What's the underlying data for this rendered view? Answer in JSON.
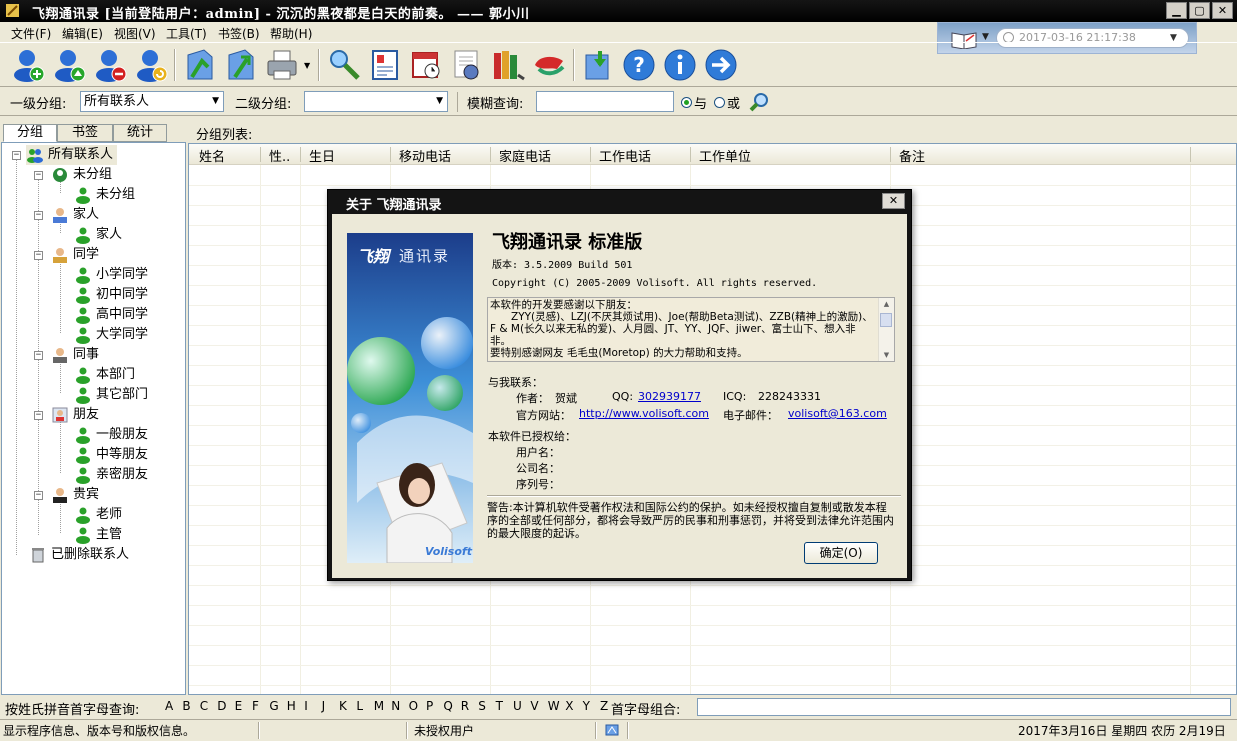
{
  "window": {
    "title": "飞翔通讯录  [当前登陆用户：admin]  -  沉沉的黑夜都是白天的前奏。 —— 郭小川"
  },
  "menu": [
    "文件(F)",
    "编辑(E)",
    "视图(V)",
    "工具(T)",
    "书签(B)",
    "帮助(H)"
  ],
  "date_widget": {
    "value": "2017-03-16 21:17:38"
  },
  "filters": {
    "group1_label": "一级分组:",
    "group1_value": "所有联系人",
    "group2_label": "二级分组:",
    "group2_value": "",
    "search_label": "模糊查询:",
    "search_value": "",
    "and_label": "与",
    "or_label": "或",
    "mode": "and"
  },
  "left_tabs": [
    "分组",
    "书签",
    "统计"
  ],
  "tree": {
    "root": "所有联系人",
    "groups": [
      {
        "label": "未分组",
        "children": [
          "未分组"
        ]
      },
      {
        "label": "家人",
        "children": [
          "家人"
        ]
      },
      {
        "label": "同学",
        "children": [
          "小学同学",
          "初中同学",
          "高中同学",
          "大学同学"
        ]
      },
      {
        "label": "同事",
        "children": [
          "本部门",
          "其它部门"
        ]
      },
      {
        "label": "朋友",
        "children": [
          "一般朋友",
          "中等朋友",
          "亲密朋友"
        ]
      },
      {
        "label": "贵宾",
        "children": [
          "老师",
          "主管"
        ]
      }
    ],
    "deleted": "已删除联系人"
  },
  "grid": {
    "label": "分组列表:",
    "columns": [
      "姓名",
      "性..",
      "生日",
      "移动电话",
      "家庭电话",
      "工作电话",
      "工作单位",
      "备注"
    ]
  },
  "alpha": {
    "label": "按姓氏拼音首字母查询:",
    "letters": [
      "A",
      "B",
      "C",
      "D",
      "E",
      "F",
      "G",
      "H",
      "I",
      "J",
      "K",
      "L",
      "M",
      "N",
      "O",
      "P",
      "Q",
      "R",
      "S",
      "T",
      "U",
      "V",
      "W",
      "X",
      "Y",
      "Z"
    ],
    "combo_label": "首字母组合:"
  },
  "status": {
    "message": "显示程序信息、版本号和版权信息。",
    "license": "未授权用户",
    "date": "2017年3月16日 星期四 农历 2月19日"
  },
  "about": {
    "title": "关于 飞翔通讯录",
    "banner_logo": "飞翔",
    "banner_text": "通讯录",
    "banner_brand": "Volisoft",
    "product": "飞翔通讯录 标准版",
    "version": "版本: 3.5.2009 Build 501",
    "copyright": "Copyright (C) 2005-2009 Volisoft. All rights reserved.",
    "thanks": [
      "本软件的开发要感谢以下朋友：",
      "　　ZYY(灵感)、LZJ(不厌其烦试用)、Joe(帮助Beta测试)、ZZB(精神上的激励)、F & M(长久以来无私的爱)、人月圆、JT、YY、JQF、jiwer、富士山下、想入非非。",
      "要特别感谢网友 毛毛虫(Moretop) 的大力帮助和支持。"
    ],
    "contact_label": "与我联系：",
    "author_label": "作者：",
    "author": "贺斌",
    "qq_label": "QQ:",
    "qq": "302939177",
    "icq_label": "ICQ:",
    "icq": "228243331",
    "site_label": "官方网站：",
    "site": "http://www.volisoft.com",
    "email_label": "电子邮件：",
    "email": "volisoft@163.com",
    "licensed_label": "本软件已授权给：",
    "user_label": "用户名：",
    "company_label": "公司名：",
    "serial_label": "序列号：",
    "warning": "警告:本计算机软件受著作权法和国际公约的保护。如未经授权擅自复制或散发本程序的全部或任何部分，都将会导致严厉的民事和刑事惩罚，并将受到法律允许范围内的最大限度的起诉。",
    "ok": "确定(O)"
  }
}
